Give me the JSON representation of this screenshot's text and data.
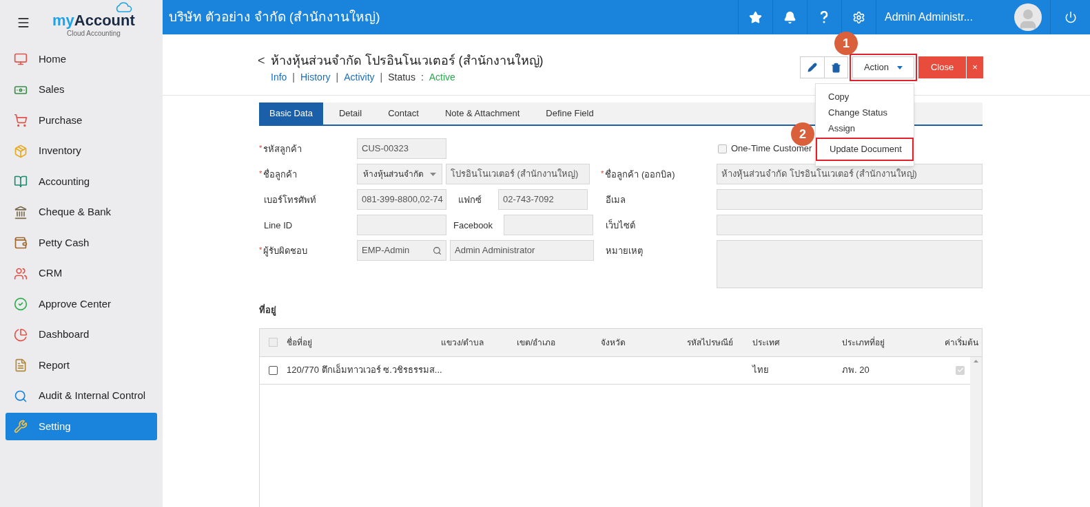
{
  "sidebar": {
    "logo": {
      "part1": "my",
      "part2": "Account",
      "tagline": "Cloud Accounting"
    },
    "items": [
      {
        "label": "Home",
        "selected": false
      },
      {
        "label": "Sales",
        "selected": false
      },
      {
        "label": "Purchase",
        "selected": false
      },
      {
        "label": "Inventory",
        "selected": false
      },
      {
        "label": "Accounting",
        "selected": false
      },
      {
        "label": "Cheque & Bank",
        "selected": false
      },
      {
        "label": "Petty Cash",
        "selected": false
      },
      {
        "label": "CRM",
        "selected": false
      },
      {
        "label": "Approve Center",
        "selected": false
      },
      {
        "label": "Dashboard",
        "selected": false
      },
      {
        "label": "Report",
        "selected": false
      },
      {
        "label": "Audit & Internal Control",
        "selected": false
      },
      {
        "label": "Setting",
        "selected": true
      }
    ]
  },
  "topbar": {
    "company": "บริษัท ตัวอย่าง จำกัด (สำนักงานใหญ่)",
    "user": "Admin Administr..."
  },
  "header": {
    "back": "<",
    "title": "ห้างหุ้นส่วนจำกัด โปรอินโนเวเตอร์ (สำนักงานใหญ่)",
    "links": [
      {
        "label": "Info",
        "sep": "|"
      },
      {
        "label": "History",
        "sep": "|"
      },
      {
        "label": "Activity",
        "sep": "|"
      }
    ],
    "status_label": "Status",
    "status_sep": ":",
    "status_value": "Active",
    "action": "Action",
    "close": "Close",
    "close_x": "×"
  },
  "action_menu": {
    "items": [
      {
        "label": "Copy",
        "highlighted": false
      },
      {
        "label": "Change Status",
        "highlighted": false
      },
      {
        "label": "Assign",
        "highlighted": false
      },
      {
        "label": "Update Document",
        "highlighted": true
      }
    ]
  },
  "callouts": [
    {
      "number": "1"
    },
    {
      "number": "2"
    }
  ],
  "tabs": [
    {
      "label": "Basic Data",
      "selected": true
    },
    {
      "label": "Detail",
      "selected": false
    },
    {
      "label": "Contact",
      "selected": false
    },
    {
      "label": "Note & Attachment",
      "selected": false
    },
    {
      "label": "Define Field",
      "selected": false
    }
  ],
  "form": {
    "customer_code": {
      "label": "รหัสลูกค้า",
      "mark": "*",
      "value": "CUS-00323"
    },
    "one_time_customer": {
      "label": "One-Time Customer",
      "checked": false
    },
    "customer_name": {
      "label": "ชื่อลูกค้า",
      "mark": "*",
      "prefix": "ห้างหุ้นส่วนจำกัด",
      "value": "โปรอินโนเวเตอร์ (สำนักงานใหญ่)"
    },
    "billing_name": {
      "label": "ชื่อลูกค้า (ออกบิล)",
      "mark": "*",
      "value": "ห้างหุ้นส่วนจำกัด โปรอินโนเวเตอร์ (สำนักงานใหญ่)"
    },
    "phone": {
      "label": "เบอร์โทรศัพท์",
      "value": "081-399-8800,02-74"
    },
    "fax": {
      "label": "แฟกซ์",
      "value": "02-743-7092"
    },
    "email": {
      "label": "อีเมล"
    },
    "line_id": {
      "label": "Line ID"
    },
    "facebook": {
      "label": "Facebook"
    },
    "website": {
      "label": "เว็บไซต์"
    },
    "responsible": {
      "label": "ผู้รับผิดชอบ",
      "mark": "*",
      "value": "EMP-Admin",
      "name_value": "Admin Administrator"
    },
    "note": {
      "label": "หมายเหตุ"
    }
  },
  "address": {
    "title": "ที่อยู่",
    "select_all": {
      "checked": false,
      "disabled": true
    },
    "columns": [
      "ชื่อที่อยู่",
      "แขวง/ตำบล",
      "เขต/อำเภอ",
      "จังหวัด",
      "รหัสไปรษณีย์",
      "ประเทศ",
      "ประเภทที่อยู่",
      "ค่าเริ่มต้น"
    ],
    "rows": [
      {
        "checked": false,
        "cells": [
          "120/770 ตึกเอ็มทาวเวอร์ ซ.วชิรธรรมส...",
          "",
          "",
          "",
          "",
          "ไทย",
          "ภพ. 20"
        ],
        "default": true
      }
    ]
  }
}
